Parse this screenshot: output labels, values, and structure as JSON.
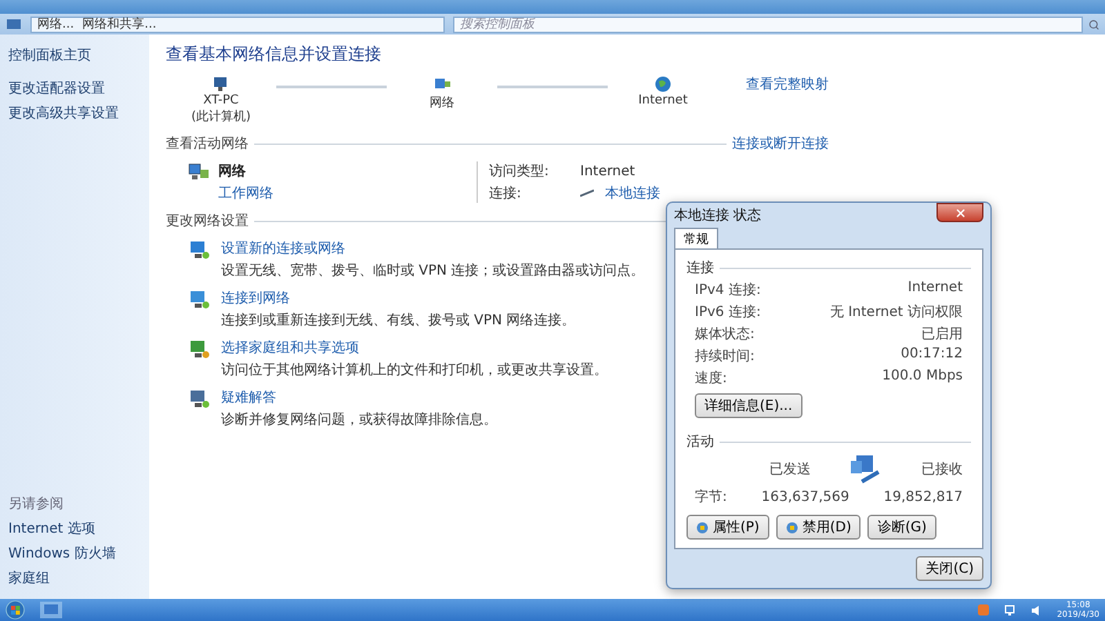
{
  "window": {
    "breadcrumbs": [
      "网络...",
      "网络和共享..."
    ],
    "search": {
      "placeholder": "搜索控制面板"
    }
  },
  "sidebar": {
    "links": [
      "控制面板主页",
      "更改适配器设置",
      "更改高级共享设置"
    ],
    "see_also": {
      "title": "另请参阅",
      "links": [
        "Internet 选项",
        "Windows 防火墙",
        "家庭组"
      ]
    }
  },
  "main": {
    "title": "查看基本网络信息并设置连接",
    "map": {
      "nodes": [
        {
          "kind": "computer",
          "label": "XT-PC",
          "sublabel": "(此计算机)"
        },
        {
          "kind": "network",
          "label": "网络"
        },
        {
          "kind": "globe",
          "label": "Internet"
        }
      ],
      "full_map_link": "查看完整映射"
    },
    "active_networks": {
      "heading": "查看活动网络",
      "link": "连接或断开连接",
      "network": {
        "name": "网络",
        "type": "工作网络"
      },
      "details": [
        {
          "kind": "text",
          "label": "访问类型:",
          "value": "Internet"
        },
        {
          "kind": "link",
          "label": "连接:",
          "value": "本地连接"
        }
      ]
    },
    "change_settings": {
      "heading": "更改网络设置",
      "tasks": [
        {
          "kind": "new-connection",
          "title": "设置新的连接或网络",
          "description": "设置无线、宽带、拨号、临时或 VPN 连接；或设置路由器或访问点。"
        },
        {
          "kind": "connect",
          "title": "连接到网络",
          "description": "连接到或重新连接到无线、有线、拨号或 VPN 网络连接。"
        },
        {
          "kind": "sharing",
          "title": "选择家庭组和共享选项",
          "description": "访问位于其他网络计算机上的文件和打印机，或更改共享设置。"
        },
        {
          "kind": "troubleshoot",
          "title": "疑难解答",
          "description": "诊断并修复网络问题，或获得故障排除信息。"
        }
      ]
    }
  },
  "dialog": {
    "title": "本地连接 状态",
    "tabs": [
      {
        "label": "常规",
        "selected": true
      }
    ],
    "connection": {
      "heading": "连接",
      "rows": [
        {
          "label": "IPv4 连接:",
          "value": "Internet"
        },
        {
          "label": "IPv6 连接:",
          "value": "无 Internet 访问权限"
        },
        {
          "label": "媒体状态:",
          "value": "已启用"
        },
        {
          "label": "持续时间:",
          "value": "00:17:12"
        },
        {
          "label": "速度:",
          "value": "100.0 Mbps"
        }
      ]
    },
    "details_button": "详细信息(E)...",
    "activity": {
      "heading": "活动",
      "sent_label": "已发送",
      "received_label": "已接收",
      "bytes_label": "字节:",
      "sent": "163,637,569",
      "received": "19,852,817"
    },
    "buttons": [
      "属性(P)",
      "禁用(D)",
      "诊断(G)"
    ],
    "close_button": "关闭(C)"
  },
  "taskbar": {
    "time": "15:08",
    "date": "2019/4/30"
  }
}
